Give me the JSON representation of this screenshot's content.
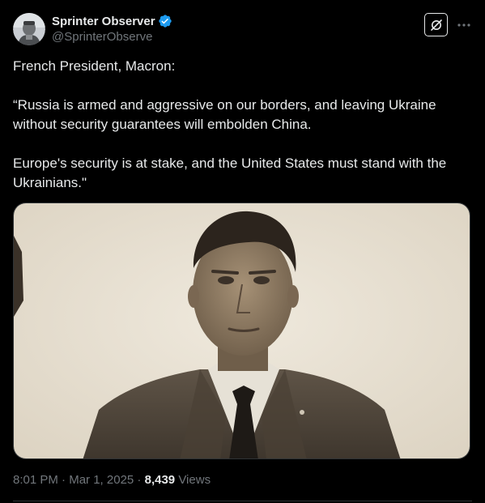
{
  "author": {
    "display_name": "Sprinter Observer",
    "handle": "@SprinterObserve",
    "verified": true,
    "verified_color": "#1d9bf0",
    "avatar_icon": "avatar-image"
  },
  "actions": {
    "grok_icon": "grok-icon",
    "more_icon": "more-horizontal-icon"
  },
  "tweet": {
    "paragraphs": [
      "French President, Macron:",
      "“Russia is armed and aggressive on our borders, and leaving Ukraine without security guarantees will embolden China.",
      "Europe's security is at stake, and the United States must stand with the Ukrainians.\""
    ]
  },
  "media": {
    "type": "photo",
    "tone": "sepia"
  },
  "meta": {
    "time": "8:01 PM",
    "separator": " · ",
    "date": "Mar 1, 2025",
    "views_count": "8,439",
    "views_label": "Views"
  },
  "colors": {
    "background": "#000000",
    "text": "#e7e9ea",
    "secondary": "#71767b",
    "border": "#2f3336"
  }
}
